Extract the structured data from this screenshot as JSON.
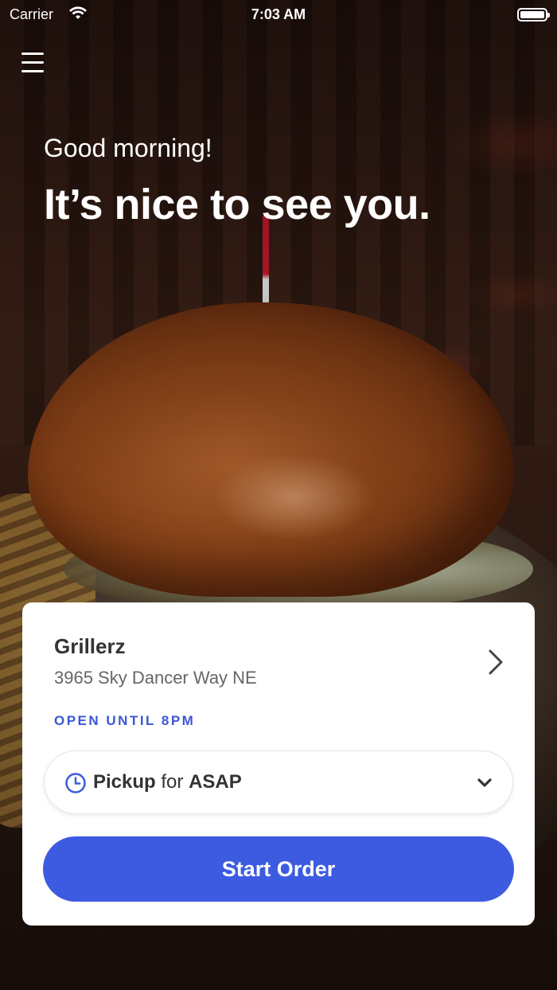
{
  "status_bar": {
    "carrier": "Carrier",
    "time": "7:03 AM"
  },
  "hero": {
    "greeting": "Good morning!",
    "headline": "It’s nice to see you."
  },
  "store": {
    "name": "Grillerz",
    "address": "3965 Sky Dancer Way NE",
    "hours": "OPEN UNTIL 8PM"
  },
  "order_mode": {
    "mode": "Pickup",
    "connector": "for",
    "time": "ASAP"
  },
  "start_button_label": "Start Order",
  "colors": {
    "accent": "#3d5be0",
    "hours_text": "#3a57d6"
  },
  "icons": {
    "menu": "hamburger-icon",
    "store_link": "chevron-right-icon",
    "time": "clock-icon",
    "dropdown": "chevron-down-icon",
    "wifi": "wifi-icon",
    "battery": "battery-icon"
  }
}
